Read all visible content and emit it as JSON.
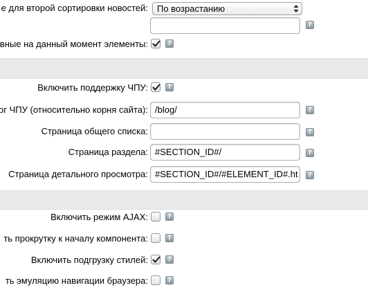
{
  "rows": {
    "second_sort": {
      "label": "е для второй сортировки новостей:",
      "select_value": "По возрастанию"
    },
    "active_elements": {
      "label": "ивные на данный момент элементы:",
      "checked": true
    },
    "sef_enable": {
      "label": "Включить поддержку ЧПУ:",
      "checked": true
    },
    "sef_folder": {
      "label": "ог ЧПУ (относительно корня сайта):",
      "value": "/blog/"
    },
    "list_page": {
      "label": "Страница общего списка:",
      "value": ""
    },
    "section_page": {
      "label": "Страница раздела:",
      "value": "#SECTION_ID#/"
    },
    "detail_page": {
      "label": "Страница детального просмотра:",
      "value": "#SECTION_ID#/#ELEMENT_ID#.ht"
    },
    "ajax_mode": {
      "label": "Включить режим AJAX:",
      "checked": false
    },
    "ajax_scroll": {
      "label": "ть прокрутку к началу компонента:",
      "checked": false
    },
    "ajax_styles": {
      "label": "Включить подгрузку стилей:",
      "checked": true
    },
    "ajax_history": {
      "label": "ть эмуляцию навигации браузера:",
      "checked": false
    }
  },
  "help_glyph": "?",
  "icons": {
    "help": "help-icon",
    "check": "checkmark-icon",
    "select_arrows": "select-arrows-icon"
  },
  "colors": {
    "section_band": "#e8eaeb",
    "help_button": "#8a98a1"
  }
}
